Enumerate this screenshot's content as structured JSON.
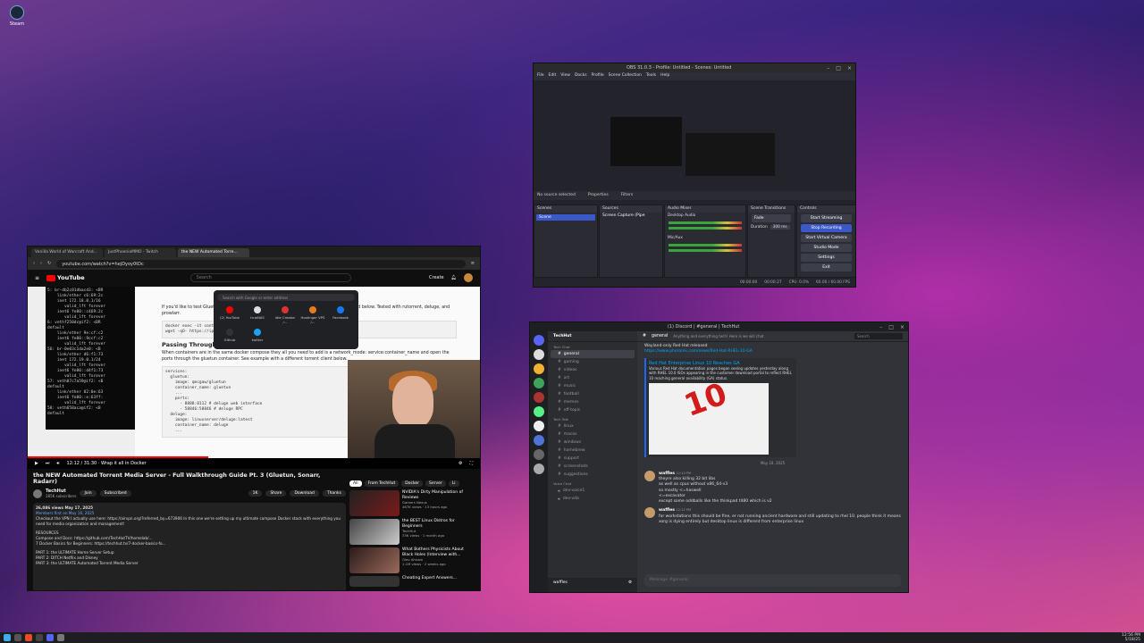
{
  "desktop": {
    "steam_label": "Steam"
  },
  "browser": {
    "tabs": [
      "Vanilla World of Warcraft And...",
      "JustPhoenixMMO - Twitch",
      "the NEW Automated Torre..."
    ],
    "url": "youtube.com/watch?v=hejDyoy0tDc",
    "yt_search_placeholder": "Search",
    "create_label": "Create",
    "video_time": "12:12 / 31:30 · Wrap it all in Docker",
    "video_title": "the NEW Automated Torrent Media Server - Full Walkthrough Guide Pt. 3 (Gluetun, Sonarr, Radarr)",
    "channel": "TechHut",
    "subs": "285K subscribers",
    "join": "Join",
    "subscribed": "Subscribed",
    "likes": "1K",
    "share": "Share",
    "download": "Download",
    "thanks": "Thanks",
    "desc_line1": "26,086 views  May 17, 2025",
    "desc_members": "Members first on May 16, 2025",
    "desc_line2": "Checkout the VPN I actually use here: https://airvpn.org/?referred_by=673906 In this one we're setting up my ultimate compose Docker stack with everything you need for media organization and management!",
    "desc_resources": "RESOURCES",
    "desc_compose": "Compose and Docs: https://github.com/TechHutTV/homelab/...",
    "desc_basics": "7 Docker Basics for Beginners: https://techhut.tv/7-docker-basics-fo...",
    "desc_parts": [
      "PART 1: the ULTIMATE Home Server Setup",
      "PART 2: DITCH Netflix and Disney",
      "PART 3: the ULTIMATE Automated Torrent Media Server"
    ],
    "article_text1": "If you'd like to test Gluetun Connection run the command below and run the wget command below. Tested with rutorrent, deluge, and prowlarr.",
    "article_cmd": "docker exec -it container_name\nwget -qO- https://ipinfo.io",
    "article_h": "Passing Through Containers",
    "article_text2": "When containers are in the same docker compose they all you need to add is a network_mode: service:container_name and open the ports through the gluetun container. See example with a different torrent client below.",
    "article_code": "services:\n  gluetun:\n    image: qmcgaw/gluetun\n    container_name: gluetun\n    ...\n    ports:\n      - 8888:8112 # deluge web interface\n      - 58846:58846 # deluge RPC\n  deluge:\n    image: linuxserver/deluge:latest\n    container_name: deluge\n    ...",
    "term_text": "5: br-db2c01dbacd3: <BR\n    link/ether c6:69:2c\n    inet 172.18.0.1/16\n       valid_lft forever\n    inet6 fe80::c469:2c\n       valid_lft forever\n6: vethf250dc@if2: <BR\ndefault\n    link/ether 9e:cf:c2\n    inet6 fe80::9ccf:c2\n       valid_lft forever\n56: br-0e03c1da2e0: <B\n    link/ether d6:f1:73\n    inet 172.19.0.1/24\n       valid_lft forever\n    inet6 fe80::d4f1:73\n       valid_lft forever\n57: veth07c7a59@if2: <B\ndefault\n    link/ether 02:0e:63\n    inet6 fe80::e:63ff:\n       valid_lft forever\n58: veth658aca@if2: <B\ndefault",
    "newtab_search": "Search with Google or enter address",
    "shortcuts": [
      "(2) YouTube",
      "trueNAS",
      "idle Creator /...",
      "Hostinger VPS /...",
      "Facebook",
      "Github",
      "twitter"
    ],
    "chips": [
      "All",
      "From TechHut",
      "Docker",
      "Server",
      "Li"
    ],
    "recs": [
      {
        "title": "NVIDIA's Dirty Manipulation of Reviews",
        "channel": "Gamers Nexus",
        "stats": "467K views · 13 hours ago"
      },
      {
        "title": "the BEST Linux Distros for Beginners",
        "channel": "TechHut",
        "stats": "33K views · 1 month ago"
      },
      {
        "title": "What Bothers Physicists About Black Holes (Interview with...",
        "channel": "Olav Ahnam",
        "stats": "1.1M views · 2 weeks ago"
      },
      {
        "title": "Cheating Expert Answers...",
        "channel": "",
        "stats": ""
      }
    ]
  },
  "obs": {
    "title": "OBS 31.0.3 - Profile: Untitled - Scenes: Untitled",
    "menu": [
      "File",
      "Edit",
      "View",
      "Docks",
      "Profile",
      "Scene Collection",
      "Tools",
      "Help"
    ],
    "no_source": "No source selected",
    "properties": "Properties",
    "filters": "Filters",
    "scenes_h": "Scenes",
    "scene": "Scene",
    "sources_h": "Sources",
    "source": "Screen Capture (Pipe",
    "mixer_h": "Audio Mixer",
    "desktop_audio": "Desktop Audio",
    "mic": "Mic/Aux",
    "trans_h": "Scene Transitions",
    "fade": "Fade",
    "duration_label": "Duration",
    "duration": "300 ms",
    "controls_h": "Controls",
    "buttons": [
      "Start Streaming",
      "Stop Recording",
      "Start Virtual Camera",
      "Studio Mode",
      "Settings",
      "Exit"
    ],
    "status": [
      "00:00:00",
      "00:00:27",
      "CPU: 0.0%",
      "60.00 / 60.00 FPS"
    ]
  },
  "discord": {
    "title": "(1) Discord | #general | TechHut",
    "server": "TechHut",
    "cat1": "Tech Chat",
    "channels1": [
      "general",
      "gaming",
      "videos",
      "art",
      "music",
      "football",
      "memes",
      "off-topic"
    ],
    "cat2": "Tech Talk",
    "channels2": [
      "linux",
      "macos",
      "windows",
      "homebrew",
      "support",
      "screenshots",
      "suggestions"
    ],
    "cat3": "Voice Chat",
    "channels3": [
      "dev-voice1",
      "dev-vda"
    ],
    "user": "waffles",
    "channel_head": "general",
    "topic": "Anything and everything tech! Here is we will chat",
    "search": "Search",
    "msg_top": "Wayland-only Red Hat released",
    "msg_link": "https://www.phoronix.com/news/Red-Hat-RHEL-10-GA",
    "embed_title": "Red Hat Enterprise Linux 10 Reaches GA",
    "embed_text": "Various Red Hat documentation pages began seeing updates yesterday along with RHEL 10.0 ISOs appearing in the customer download portal to reflect RHEL 10 reaching general availability (GA) status.",
    "date": "May 18, 2025",
    "msg1_author": "waffles",
    "msg1_time": "12:10 PM",
    "msg1_lines": [
      "theyre also killing 32 bit libs",
      "as well as cpus without x86_64-v3",
      "so mostly <=haswell",
      "<=excavator",
      "except some oddballs like the thinkpad t480 which is v2"
    ],
    "msg2_author": "waffles",
    "msg2_time": "12:12 PM",
    "msg2_text": "for workstations this should be fine, er not running ancient hardware and still updating to rhel 10. people think it means xorg is dying entirely but desktop linux is different from enterprise linux",
    "composer": "Message #general"
  },
  "taskbar": {
    "time": "12:56 PM",
    "date": "5/18/25"
  }
}
